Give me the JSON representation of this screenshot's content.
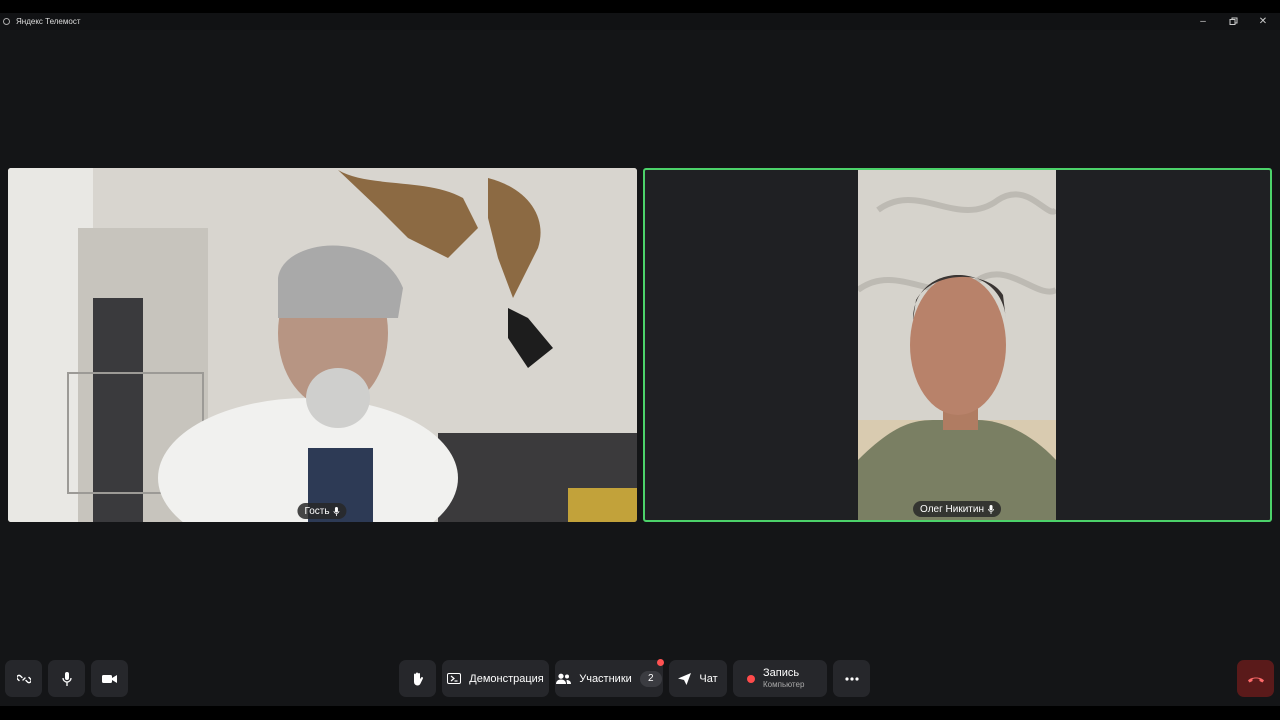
{
  "window": {
    "title": "Яндекс Телемост"
  },
  "participants": [
    {
      "name": "Гость"
    },
    {
      "name": "Олег Никитин"
    }
  ],
  "toolbar": {
    "demo_label": "Демонстрация",
    "participants_label": "Участники",
    "participants_count": "2",
    "chat_label": "Чат",
    "record_label": "Запись",
    "record_sub": "Компьютер"
  },
  "icons": {
    "link": "link-icon",
    "mic": "microphone-icon",
    "camera": "camera-icon",
    "hand": "raise-hand-icon",
    "screen": "screen-share-icon",
    "people": "participants-icon",
    "chat": "chat-send-icon",
    "more": "more-dots-icon",
    "hangup": "phone-hangup-icon"
  },
  "colors": {
    "active_speaker_border": "#4cd26a",
    "notification_dot": "#ff5252",
    "record_dot": "#ff4b4b"
  }
}
